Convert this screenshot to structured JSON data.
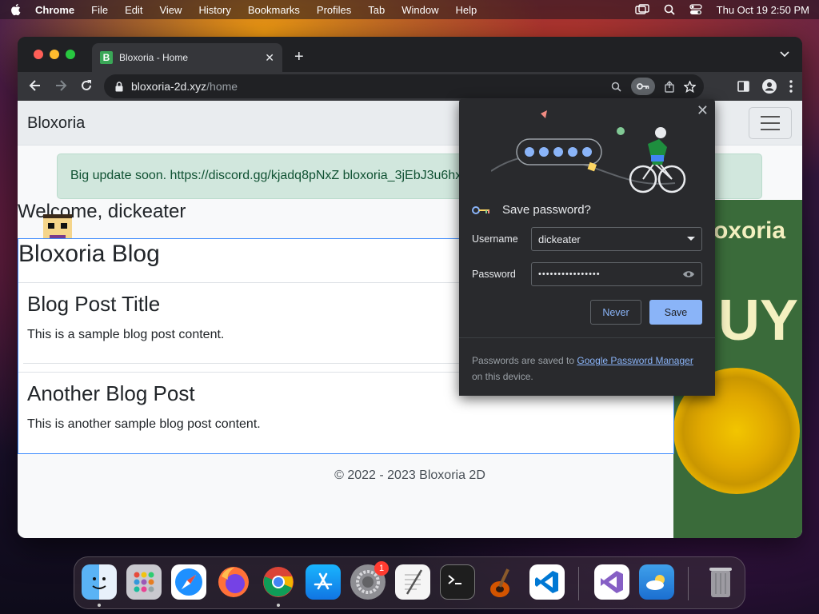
{
  "menubar": {
    "app_name": "Chrome",
    "items": [
      "File",
      "Edit",
      "View",
      "History",
      "Bookmarks",
      "Profiles",
      "Tab",
      "Window",
      "Help"
    ],
    "clock": "Thu Oct 19  2:50 PM"
  },
  "browser": {
    "tab_title": "Bloxoria - Home",
    "favicon_letter": "B",
    "url_host": "bloxoria-2d.xyz",
    "url_path": "/home"
  },
  "site": {
    "brand": "Bloxoria",
    "alert": "Big update soon. https://discord.gg/kjadq8pNxZ bloxoria_3jEbJ3u6hxGTBXtSP",
    "welcome": "Welcome, dickeater",
    "blog_title": "Bloxoria Blog",
    "posts": [
      {
        "title": "Blog Post Title",
        "content": "This is a sample blog post content."
      },
      {
        "title": "Another Blog Post",
        "content": "This is another sample blog post content."
      }
    ],
    "footer": "© 2022 - 2023 Bloxoria 2D",
    "ad_text_1": "oxoria",
    "ad_text_2": "UY"
  },
  "password_dialog": {
    "title": "Save password?",
    "username_label": "Username",
    "username_value": "dickeater",
    "password_label": "Password",
    "password_mask": "••••••••••••••••",
    "never_label": "Never",
    "save_label": "Save",
    "footer_prefix": "Passwords are saved to ",
    "footer_link": "Google Password Manager",
    "footer_suffix": "on this device."
  },
  "dock": {
    "apps": [
      "finder-icon",
      "launchpad-icon",
      "safari-icon",
      "firefox-icon",
      "chrome-icon",
      "app-store-icon",
      "system-settings-icon",
      "textedit-icon",
      "terminal-icon",
      "garageband-icon",
      "vscode-icon",
      "visual-studio-icon",
      "weather-icon",
      "trash-icon"
    ],
    "settings_badge": "1"
  }
}
